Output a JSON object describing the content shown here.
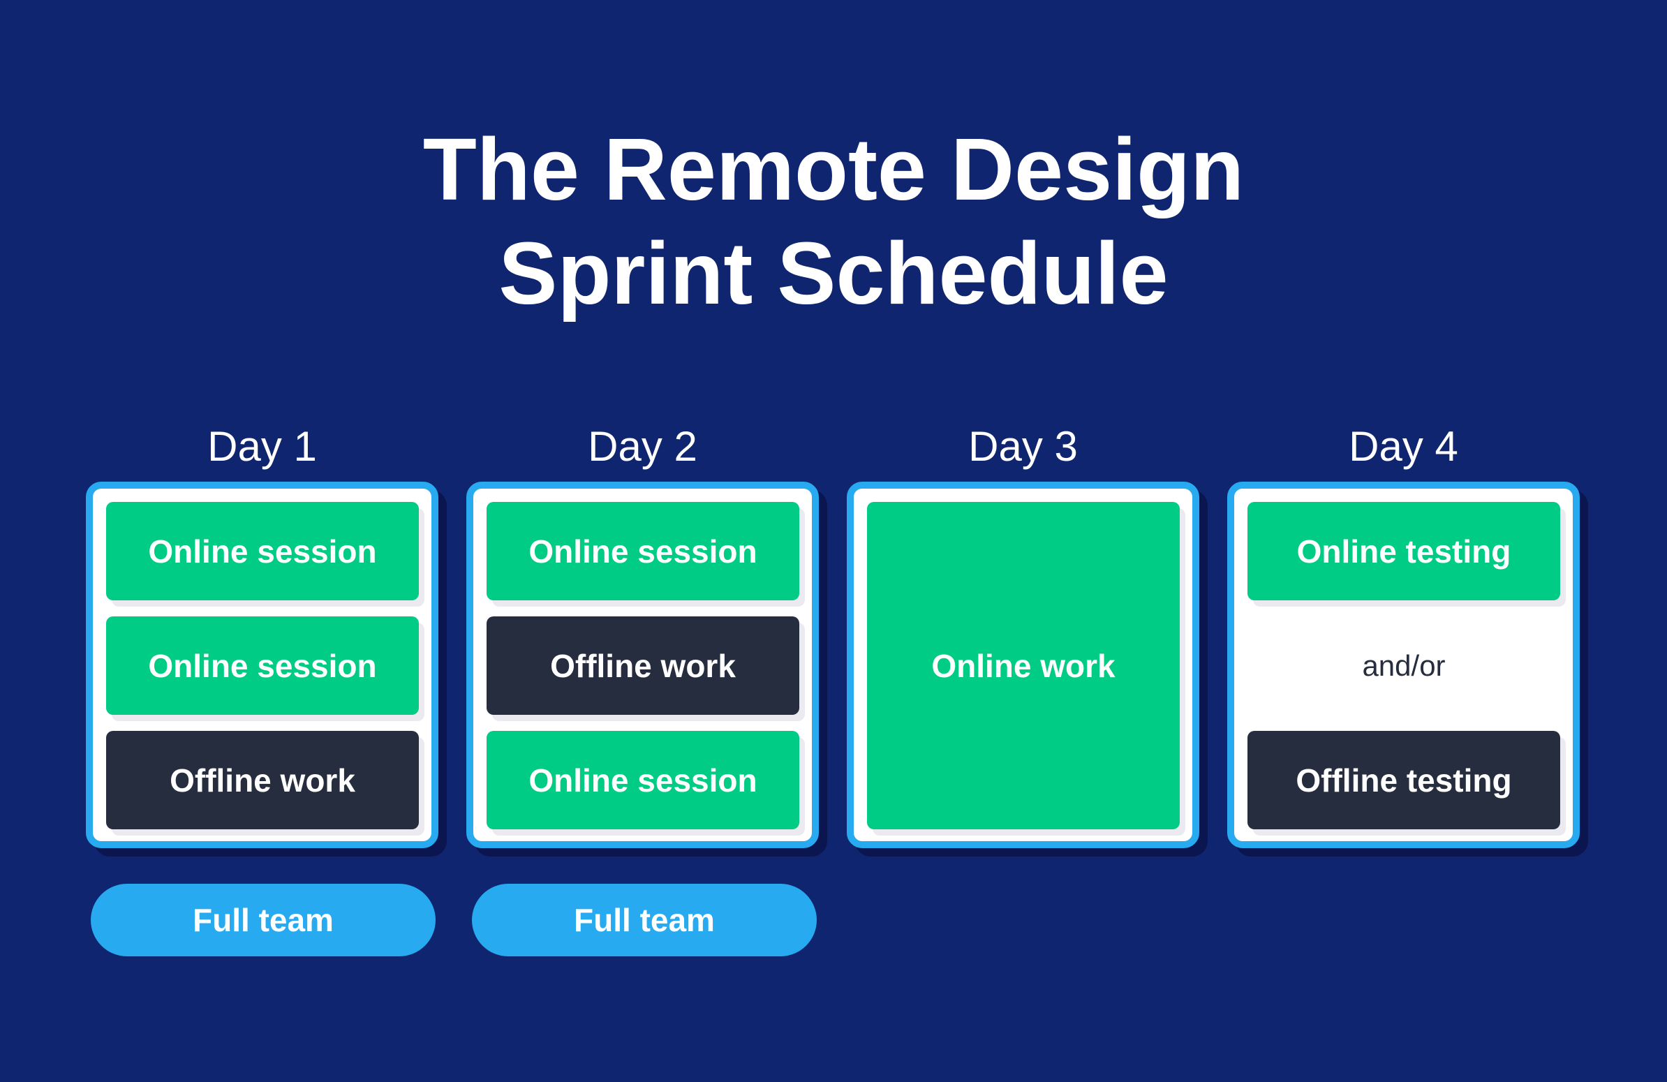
{
  "title": {
    "line1": "The Remote Design",
    "line2": "Sprint Schedule"
  },
  "colors": {
    "background": "#10256F",
    "card_border": "#27AAF0",
    "online": "#00CC85",
    "offline": "#262D3E",
    "pill": "#27AAF0",
    "shadow": "#0B1650"
  },
  "days": [
    {
      "label": "Day 1",
      "blocks": [
        {
          "label": "Online session",
          "type": "online"
        },
        {
          "label": "Online session",
          "type": "online"
        },
        {
          "label": "Offline work",
          "type": "offline"
        }
      ],
      "team": "Full team"
    },
    {
      "label": "Day 2",
      "blocks": [
        {
          "label": "Online session",
          "type": "online"
        },
        {
          "label": "Offline work",
          "type": "offline"
        },
        {
          "label": "Online session",
          "type": "online"
        }
      ],
      "team": "Full team"
    },
    {
      "label": "Day 3",
      "blocks": [
        {
          "label": "Online work",
          "type": "online"
        }
      ]
    },
    {
      "label": "Day 4",
      "blocks": [
        {
          "label": "Online testing",
          "type": "online"
        },
        {
          "label": "Offline testing",
          "type": "offline"
        }
      ],
      "separator": "and/or"
    }
  ]
}
